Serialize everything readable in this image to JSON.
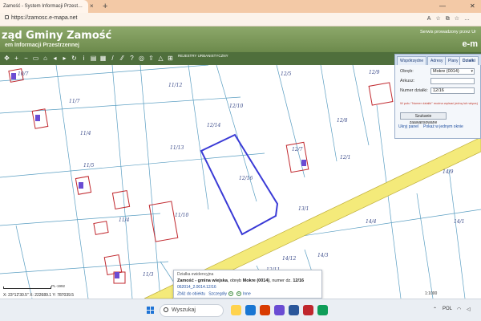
{
  "browser": {
    "tab_title": "Zamość - System Informacji Przest…",
    "tab_close": "×",
    "new_tab": "+",
    "url": "https://zamosc.e-mapa.net",
    "minimize": "—",
    "close": "✕"
  },
  "header": {
    "title": "ząd Gminy Zamość",
    "subtitle": "em Informacji Przestrzennej",
    "right_note": "Serwis prowadzony przez Ur",
    "brand": "e-m"
  },
  "toolbar": {
    "rejestry": "REJESTRY URBANISTYCZNY"
  },
  "panel": {
    "tabs": [
      "Współrzędne",
      "Adresy",
      "Plany",
      "Działki"
    ],
    "active_tab": "Działki",
    "obreb_label": "Obręb:",
    "obreb_value": "Mokre (0014)",
    "arkusz_label": "Arkusz:",
    "arkusz_value": "",
    "numer_label": "Numer działki:",
    "numer_value": "12/16",
    "hint": "W polu \"Numer działki\" można wpisać jedną lub więcej",
    "search_button": "Szukanie zaawansowane",
    "link_hide": "Ukryj panel",
    "link_show_all": "Pokaż w jednym oknie"
  },
  "popup": {
    "heading": "Działka ewidencyjna",
    "line_prefix": "Zamość - gmina wiejska",
    "line_obreb_text": ", obręb ",
    "line_obreb": "Mokre (0014)",
    "line_numer_text": ", numer dz. ",
    "line_numer": "12/16",
    "id": "062014_2.0014.12/16",
    "link_zoom": "Zbliż do obiektu",
    "link_details": "Szczegóły",
    "link_other": "Inne"
  },
  "map": {
    "parcel_labels": [
      "10/7",
      "11/7",
      "11/4",
      "11/5",
      "11/12",
      "11/13",
      "12/14",
      "12/10",
      "12/5",
      "12/8",
      "12/9",
      "12/7",
      "12/16",
      "11/10",
      "11/4",
      "11/3",
      "12/1",
      "13/1",
      "14/4",
      "14/1",
      "14/9",
      "14/12",
      "14/3",
      "12/11"
    ],
    "highlight_color": "#3a3ad6",
    "road_color": "#f0e35a",
    "building_color": "#c0272d"
  },
  "status": {
    "coords": "X: 23°12'30.5\"  X: 222689.1  Y: 787039.5",
    "scale_label": "PL-1992",
    "zoom": "1:1000"
  },
  "taskbar": {
    "search": "Wyszukaj",
    "lang": "POL",
    "time": "",
    "date": ""
  }
}
